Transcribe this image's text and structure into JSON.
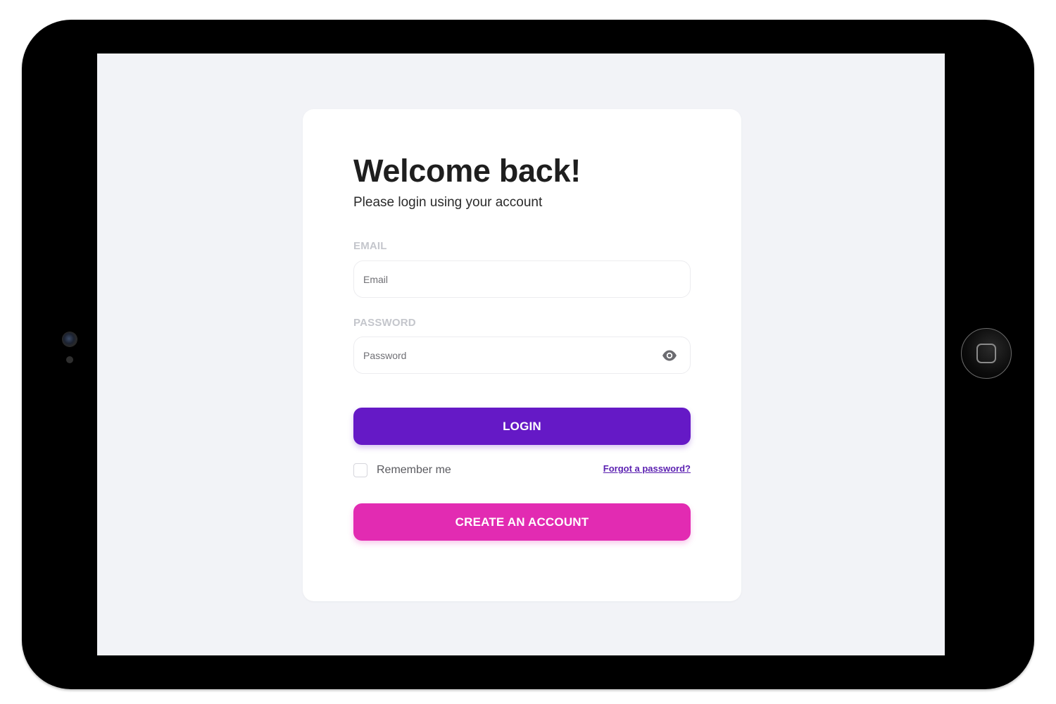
{
  "login": {
    "title": "Welcome back!",
    "subtitle": "Please login using your account",
    "email": {
      "label": "EMAIL",
      "placeholder": "Email",
      "value": ""
    },
    "password": {
      "label": "PASSWORD",
      "placeholder": "Password",
      "value": ""
    },
    "login_label": "LOGIN",
    "remember_label": "Remember me",
    "remember_checked": false,
    "forgot_label": "Forgot a password?",
    "create_label": "CREATE AN ACCOUNT"
  },
  "icons": {
    "password_toggle": "eye-icon",
    "device_home": "home-button-icon",
    "device_camera": "camera-icon"
  },
  "colors": {
    "login_button": "#6519c6",
    "create_button": "#e22bb2",
    "link": "#5a1fb0",
    "screen_background": "#f2f3f7",
    "device_frame": "#000000"
  }
}
